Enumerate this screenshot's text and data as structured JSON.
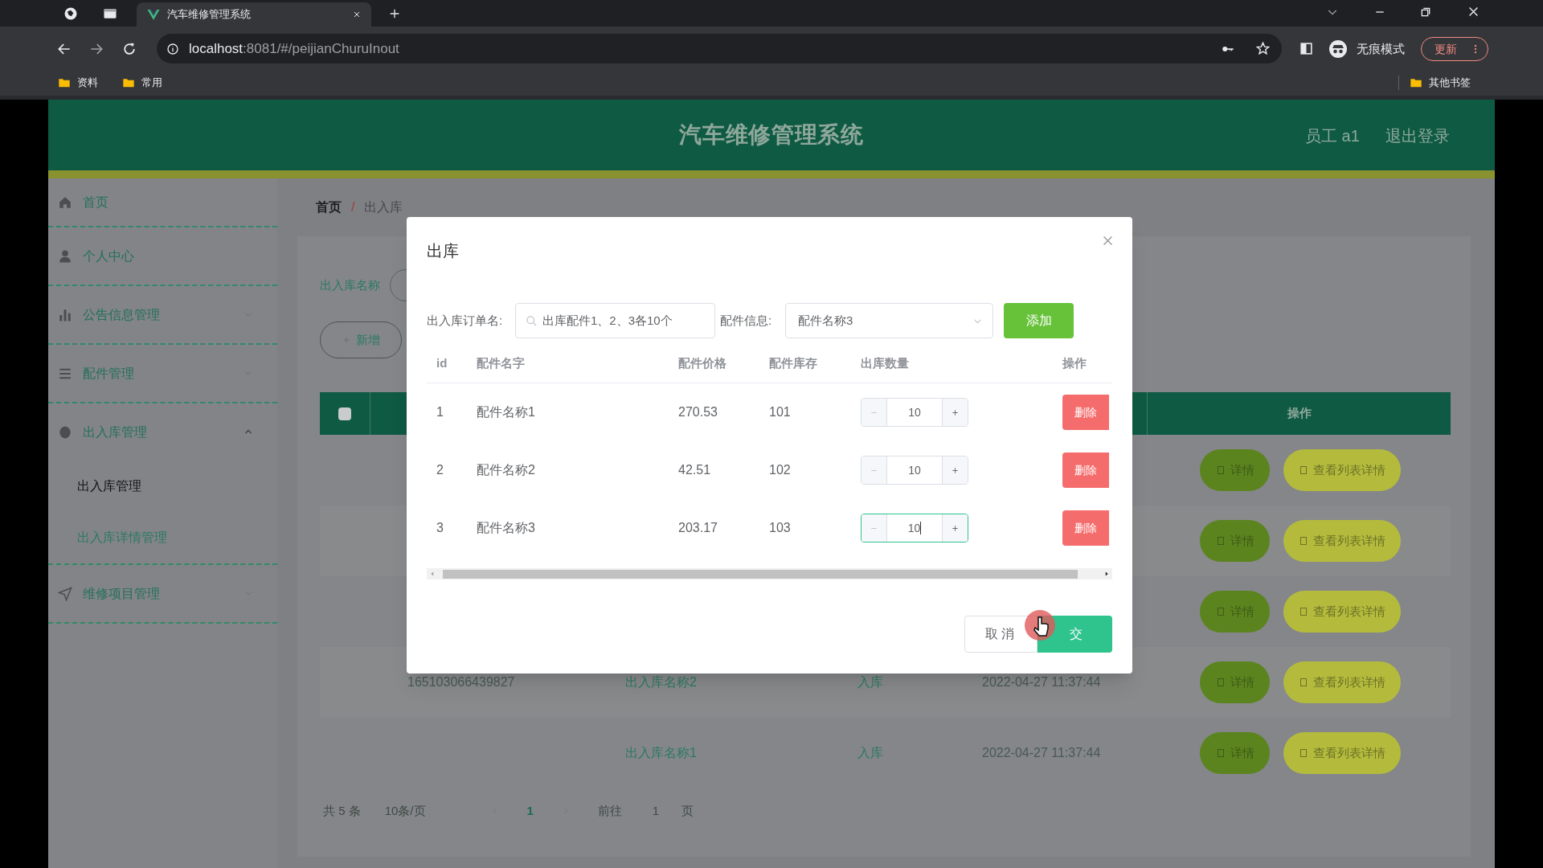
{
  "browser": {
    "tabs": [
      {
        "title": "汽车维修管理系统",
        "selected": true
      }
    ],
    "url_host": "localhost",
    "url_path": ":8081/#/peijianChuruInout",
    "profile": "无痕模式",
    "update_button": "更新",
    "bookmarks": [
      "资料",
      "常用"
    ],
    "other_bookmarks": "其他书签"
  },
  "header": {
    "title": "汽车维修管理系统",
    "user": "员工 a1",
    "logout": "退出登录"
  },
  "sidebar": {
    "items": [
      {
        "label": "首页"
      },
      {
        "label": "个人中心"
      },
      {
        "label": "公告信息管理",
        "expanded": false
      },
      {
        "label": "配件管理",
        "expanded": false
      },
      {
        "label": "出入库管理",
        "expanded": true,
        "children": [
          {
            "label": "出入库管理",
            "selected": true
          },
          {
            "label": "出入库详情管理",
            "selected": false
          }
        ]
      },
      {
        "label": "维修项目管理",
        "expanded": false
      }
    ]
  },
  "breadcrumb": [
    "首页",
    "出入库"
  ],
  "breadcrumb_separator": "/",
  "search": {
    "label": "出入库名称"
  },
  "add_button": "新增",
  "table": {
    "select_all": {
      "checked": false
    },
    "ops_column": "操作",
    "rows": [
      {
        "detail_button": "详情",
        "list_button": "查看列表详情"
      },
      {
        "detail_button": "详情",
        "list_button": "查看列表详情"
      },
      {
        "detail_button": "详情",
        "list_button": "查看列表详情"
      },
      {
        "id": "165103066439827",
        "name": "出入库名称2",
        "type": "入库",
        "time": "2022-04-27 11:37:44",
        "detail_button": "详情",
        "list_button": "查看列表详情"
      },
      {
        "name": "出入库名称1",
        "type": "入库",
        "time": "2022-04-27 11:37:44",
        "detail_button": "详情",
        "list_button": "查看列表详情"
      }
    ]
  },
  "pagination": {
    "total": "共 5 条",
    "page_size": "10条/页",
    "pages": [
      {
        "label": "1",
        "selected": true
      }
    ],
    "goto_label": "前往",
    "goto_value": "1",
    "page_unit": "页"
  },
  "dialog": {
    "title": "出库",
    "order_label": "出入库订单名:",
    "order_value": "出库配件1、2、3各10个",
    "part_label": "配件信息:",
    "part_value": "配件名称3",
    "add_button": "添加",
    "columns": [
      "id",
      "配件名字",
      "配件价格",
      "配件库存",
      "出库数量",
      "操作"
    ],
    "rows": [
      {
        "id": "1",
        "name": "配件名称1",
        "price": "270.53",
        "stock": "101",
        "qty": "10",
        "focused": false,
        "delete": "删除"
      },
      {
        "id": "2",
        "name": "配件名称2",
        "price": "42.51",
        "stock": "102",
        "qty": "10",
        "focused": false,
        "delete": "删除"
      },
      {
        "id": "3",
        "name": "配件名称3",
        "price": "203.17",
        "stock": "103",
        "qty": "10",
        "focused": true,
        "delete": "删除"
      }
    ],
    "cancel_button": "取消",
    "submit_button": "交"
  }
}
